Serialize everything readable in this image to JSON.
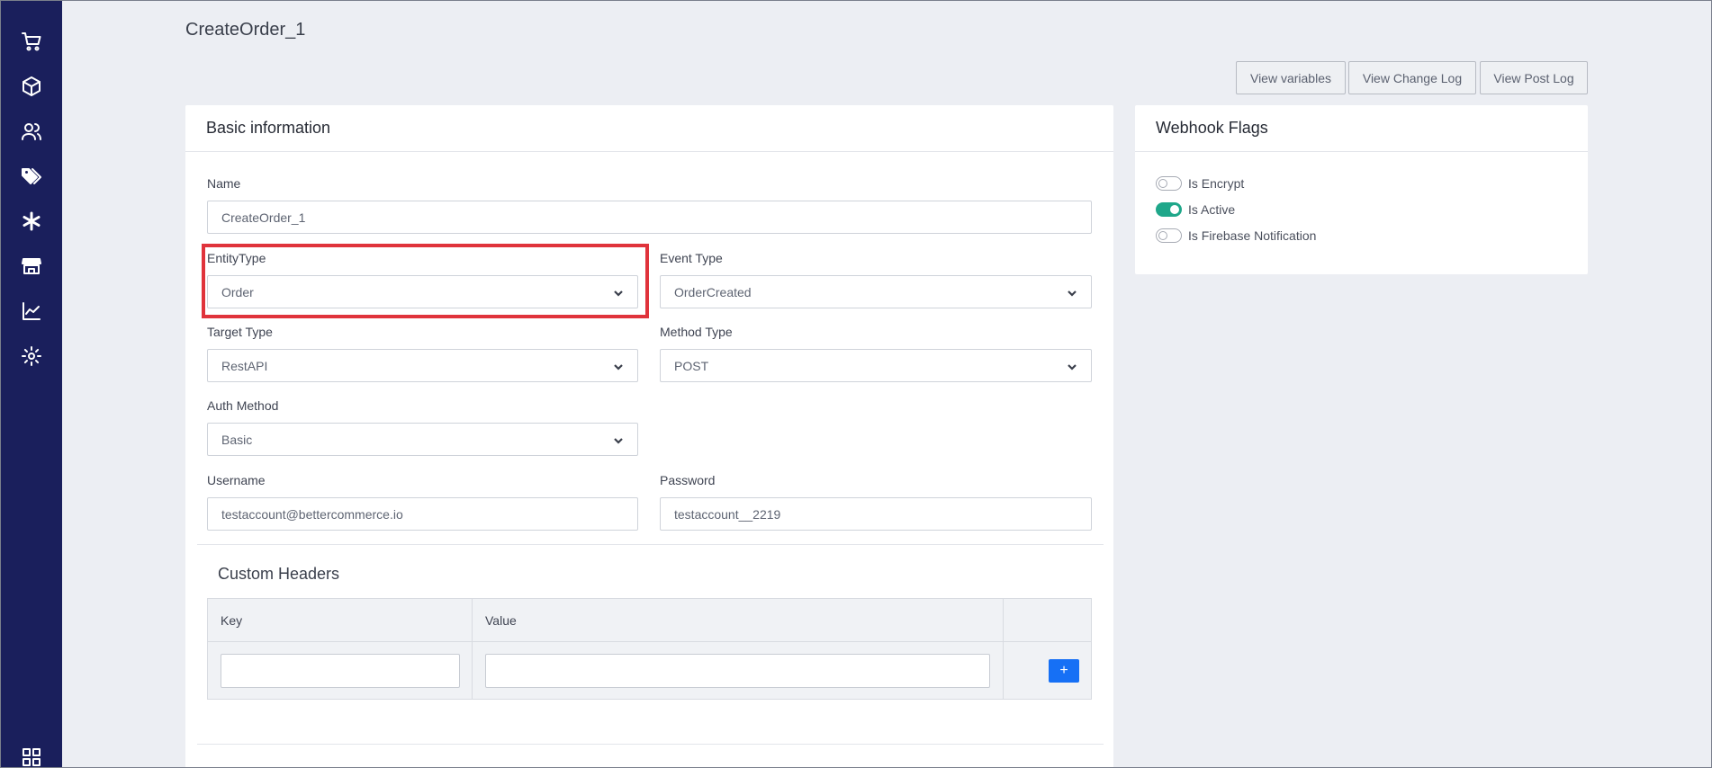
{
  "page": {
    "title": "CreateOrder_1"
  },
  "sidebar": {
    "items": [
      {
        "icon": "cart-icon"
      },
      {
        "icon": "box-icon"
      },
      {
        "icon": "users-icon"
      },
      {
        "icon": "tags-icon"
      },
      {
        "icon": "asterisk-icon"
      },
      {
        "icon": "store-icon"
      },
      {
        "icon": "chart-icon"
      },
      {
        "icon": "gear-icon"
      },
      {
        "icon": "apps-grid-icon"
      }
    ]
  },
  "toolbar": {
    "view_variables": "View variables",
    "view_change_log": "View Change Log",
    "view_post_log": "View Post Log"
  },
  "basic": {
    "title": "Basic information",
    "name_label": "Name",
    "name_value": "CreateOrder_1",
    "entity_type_label": "EntityType",
    "entity_type_value": "Order",
    "event_type_label": "Event Type",
    "event_type_value": "OrderCreated",
    "target_type_label": "Target Type",
    "target_type_value": "RestAPI",
    "method_type_label": "Method Type",
    "method_type_value": "POST",
    "auth_method_label": "Auth Method",
    "auth_method_value": "Basic",
    "username_label": "Username",
    "username_value": "testaccount@bettercommerce.io",
    "password_label": "Password",
    "password_value": "testaccount__2219"
  },
  "custom_headers": {
    "title": "Custom Headers",
    "columns": [
      "Key",
      "Value"
    ],
    "add_label": "+"
  },
  "flags": {
    "title": "Webhook Flags",
    "items": [
      {
        "label": "Is Encrypt",
        "on": false
      },
      {
        "label": "Is Active",
        "on": true
      },
      {
        "label": "Is Firebase Notification",
        "on": false
      }
    ],
    "accent": "#1fa78a"
  },
  "colors": {
    "sidebar": "#1a1f5c",
    "highlight": "#e0333b",
    "add_button": "#1670f5"
  }
}
